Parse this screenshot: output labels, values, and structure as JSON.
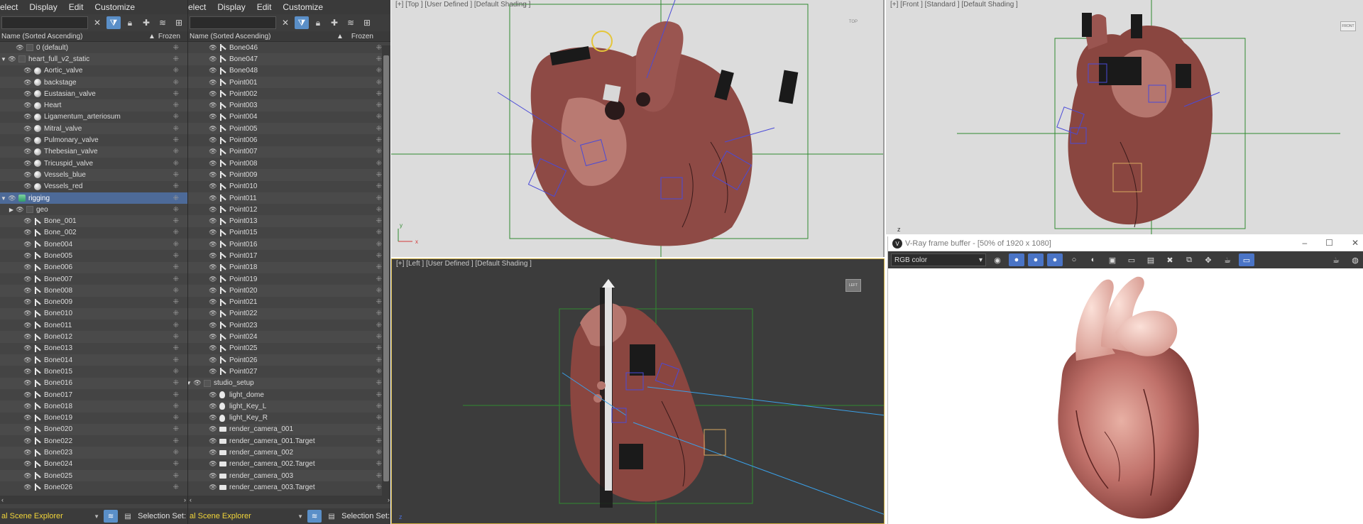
{
  "left_explorer": {
    "menu": [
      "elect",
      "Display",
      "Edit",
      "Customize"
    ],
    "header": {
      "name": "Name (Sorted Ascending)",
      "frozen": "Frozen"
    },
    "rows": [
      {
        "label": "0 (default)",
        "indent": 1,
        "icon": "dark",
        "tri": false
      },
      {
        "label": "heart_full_v2_static",
        "indent": 0,
        "icon": "dark",
        "tri": true
      },
      {
        "label": "Aortic_valve",
        "indent": 2,
        "icon": "sphere"
      },
      {
        "label": "backstage",
        "indent": 2,
        "icon": "sphere"
      },
      {
        "label": "Eustasian_valve",
        "indent": 2,
        "icon": "sphere"
      },
      {
        "label": "Heart",
        "indent": 2,
        "icon": "sphere"
      },
      {
        "label": "Ligamentum_arteriosum",
        "indent": 2,
        "icon": "sphere"
      },
      {
        "label": "Mitral_valve",
        "indent": 2,
        "icon": "sphere"
      },
      {
        "label": "Pulmonary_valve",
        "indent": 2,
        "icon": "sphere"
      },
      {
        "label": "Thebesian_valve",
        "indent": 2,
        "icon": "sphere"
      },
      {
        "label": "Tricuspid_valve",
        "indent": 2,
        "icon": "sphere"
      },
      {
        "label": "Vessels_blue",
        "indent": 2,
        "icon": "sphere"
      },
      {
        "label": "Vessels_red",
        "indent": 2,
        "icon": "sphere"
      },
      {
        "label": "rigging",
        "indent": 0,
        "icon": "layer",
        "tri": true,
        "selected": true
      },
      {
        "label": "geo",
        "indent": 1,
        "icon": "dark",
        "tri": true,
        "collapsed": true
      },
      {
        "label": "Bone_001",
        "indent": 2,
        "icon": "bone"
      },
      {
        "label": "Bone_002",
        "indent": 2,
        "icon": "bone"
      },
      {
        "label": "Bone004",
        "indent": 2,
        "icon": "bone"
      },
      {
        "label": "Bone005",
        "indent": 2,
        "icon": "bone"
      },
      {
        "label": "Bone006",
        "indent": 2,
        "icon": "bone"
      },
      {
        "label": "Bone007",
        "indent": 2,
        "icon": "bone"
      },
      {
        "label": "Bone008",
        "indent": 2,
        "icon": "bone"
      },
      {
        "label": "Bone009",
        "indent": 2,
        "icon": "bone"
      },
      {
        "label": "Bone010",
        "indent": 2,
        "icon": "bone"
      },
      {
        "label": "Bone011",
        "indent": 2,
        "icon": "bone"
      },
      {
        "label": "Bone012",
        "indent": 2,
        "icon": "bone"
      },
      {
        "label": "Bone013",
        "indent": 2,
        "icon": "bone"
      },
      {
        "label": "Bone014",
        "indent": 2,
        "icon": "bone"
      },
      {
        "label": "Bone015",
        "indent": 2,
        "icon": "bone"
      },
      {
        "label": "Bone016",
        "indent": 2,
        "icon": "bone"
      },
      {
        "label": "Bone017",
        "indent": 2,
        "icon": "bone"
      },
      {
        "label": "Bone018",
        "indent": 2,
        "icon": "bone"
      },
      {
        "label": "Bone019",
        "indent": 2,
        "icon": "bone"
      },
      {
        "label": "Bone020",
        "indent": 2,
        "icon": "bone"
      },
      {
        "label": "Bone022",
        "indent": 2,
        "icon": "bone"
      },
      {
        "label": "Bone023",
        "indent": 2,
        "icon": "bone"
      },
      {
        "label": "Bone024",
        "indent": 2,
        "icon": "bone"
      },
      {
        "label": "Bone025",
        "indent": 2,
        "icon": "bone"
      },
      {
        "label": "Bone026",
        "indent": 2,
        "icon": "bone"
      }
    ],
    "status": {
      "explorer_name": "al Scene Explorer",
      "selection_set": "Selection Set:"
    }
  },
  "right_explorer": {
    "menu": [
      "elect",
      "Display",
      "Edit",
      "Customize"
    ],
    "header": {
      "name": "Name (Sorted Ascending)",
      "frozen": "Frozen"
    },
    "rows": [
      {
        "label": "Bone046",
        "indent": 2,
        "icon": "bone"
      },
      {
        "label": "Bone047",
        "indent": 2,
        "icon": "bone"
      },
      {
        "label": "Bone048",
        "indent": 2,
        "icon": "bone"
      },
      {
        "label": "Point001",
        "indent": 2,
        "icon": "bone"
      },
      {
        "label": "Point002",
        "indent": 2,
        "icon": "bone"
      },
      {
        "label": "Point003",
        "indent": 2,
        "icon": "bone"
      },
      {
        "label": "Point004",
        "indent": 2,
        "icon": "bone"
      },
      {
        "label": "Point005",
        "indent": 2,
        "icon": "bone"
      },
      {
        "label": "Point006",
        "indent": 2,
        "icon": "bone"
      },
      {
        "label": "Point007",
        "indent": 2,
        "icon": "bone"
      },
      {
        "label": "Point008",
        "indent": 2,
        "icon": "bone"
      },
      {
        "label": "Point009",
        "indent": 2,
        "icon": "bone"
      },
      {
        "label": "Point010",
        "indent": 2,
        "icon": "bone"
      },
      {
        "label": "Point011",
        "indent": 2,
        "icon": "bone"
      },
      {
        "label": "Point012",
        "indent": 2,
        "icon": "bone"
      },
      {
        "label": "Point013",
        "indent": 2,
        "icon": "bone"
      },
      {
        "label": "Point015",
        "indent": 2,
        "icon": "bone"
      },
      {
        "label": "Point016",
        "indent": 2,
        "icon": "bone"
      },
      {
        "label": "Point017",
        "indent": 2,
        "icon": "bone"
      },
      {
        "label": "Point018",
        "indent": 2,
        "icon": "bone"
      },
      {
        "label": "Point019",
        "indent": 2,
        "icon": "bone"
      },
      {
        "label": "Point020",
        "indent": 2,
        "icon": "bone"
      },
      {
        "label": "Point021",
        "indent": 2,
        "icon": "bone"
      },
      {
        "label": "Point022",
        "indent": 2,
        "icon": "bone"
      },
      {
        "label": "Point023",
        "indent": 2,
        "icon": "bone"
      },
      {
        "label": "Point024",
        "indent": 2,
        "icon": "bone"
      },
      {
        "label": "Point025",
        "indent": 2,
        "icon": "bone"
      },
      {
        "label": "Point026",
        "indent": 2,
        "icon": "bone"
      },
      {
        "label": "Point027",
        "indent": 2,
        "icon": "bone"
      },
      {
        "label": "studio_setup",
        "indent": 0,
        "icon": "dark",
        "tri": true
      },
      {
        "label": "light_dome",
        "indent": 2,
        "icon": "bulb"
      },
      {
        "label": "light_Key_L",
        "indent": 2,
        "icon": "bulb"
      },
      {
        "label": "light_Key_R",
        "indent": 2,
        "icon": "bulb"
      },
      {
        "label": "render_camera_001",
        "indent": 2,
        "icon": "cam"
      },
      {
        "label": "render_camera_001.Target",
        "indent": 2,
        "icon": "cam"
      },
      {
        "label": "render_camera_002",
        "indent": 2,
        "icon": "cam"
      },
      {
        "label": "render_camera_002.Target",
        "indent": 2,
        "icon": "cam"
      },
      {
        "label": "render_camera_003",
        "indent": 2,
        "icon": "cam"
      },
      {
        "label": "render_camera_003.Target",
        "indent": 2,
        "icon": "cam"
      }
    ],
    "status": {
      "explorer_name": "al Scene Explorer",
      "selection_set": "Selection Set:"
    }
  },
  "viewports": {
    "top": {
      "label": "[+] [Top ] [User Defined ] [Default Shading ]",
      "viewcube": "TOP"
    },
    "front": {
      "label": "[+] [Front ] [Standard ] [Default Shading ]",
      "viewcube": "FRONT"
    },
    "left": {
      "label": "[+] [Left ] [User Defined ] [Default Shading ]",
      "viewcube": "LEFT"
    }
  },
  "framebuffer": {
    "title": "V-Ray frame buffer - [50% of 1920 x 1080]",
    "channel": "RGB color"
  },
  "colors": {
    "panel_bg": "#444444",
    "selected_row": "#4d6a98",
    "accent_blue": "#5a8fc8",
    "status_text": "#f2d53a",
    "viewport_light": "#dcdcdc",
    "viewport_dark": "#3c3c3c",
    "grid_green": "#2f8a2f"
  }
}
